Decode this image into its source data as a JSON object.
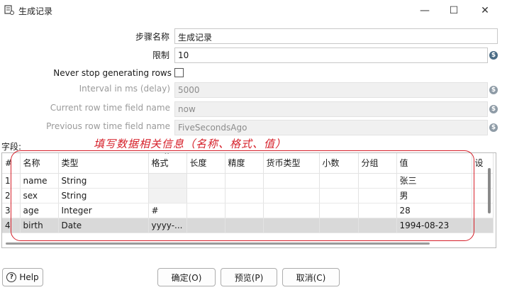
{
  "window": {
    "title": "生成记录",
    "minimize_glyph": "—",
    "maximize_glyph": "☐",
    "close_glyph": "✕"
  },
  "form": {
    "step_name_label": "步骤名称",
    "step_name_value": "生成记录",
    "limit_label": "限制",
    "limit_value": "10",
    "never_stop_label": "Never stop generating rows",
    "never_stop_checked": false,
    "interval_label": "Interval in ms (delay)",
    "interval_value": "5000",
    "current_time_label": "Current row time field name",
    "current_time_value": "now",
    "previous_time_label": "Previous row time field name",
    "previous_time_value": "FiveSecondsAgo",
    "var_icon_glyph": "$"
  },
  "fields": {
    "label": "字段:",
    "annotation": "填写数据相关信息（名称、格式、值）",
    "columns": [
      "#",
      "名称",
      "类型",
      "格式",
      "长度",
      "精度",
      "货币类型",
      "小数",
      "分组",
      "值",
      "设"
    ],
    "sort_indicator": "^",
    "rows": [
      {
        "num": "1",
        "name": "name",
        "type": "String",
        "format": "",
        "length": "",
        "precision": "",
        "currency": "",
        "decimal": "",
        "group": "",
        "value": "张三"
      },
      {
        "num": "2",
        "name": "sex",
        "type": "String",
        "format": "",
        "length": "",
        "precision": "",
        "currency": "",
        "decimal": "",
        "group": "",
        "value": "男"
      },
      {
        "num": "3",
        "name": "age",
        "type": "Integer",
        "format": "#",
        "length": "",
        "precision": "",
        "currency": "",
        "decimal": "",
        "group": "",
        "value": "28"
      },
      {
        "num": "4",
        "name": "birth",
        "type": "Date",
        "format": "yyyy-...",
        "length": "",
        "precision": "",
        "currency": "",
        "decimal": "",
        "group": "",
        "value": "1994-08-23"
      }
    ],
    "selected_row": 3
  },
  "buttons": {
    "help": "Help",
    "help_glyph": "?",
    "ok": "确定(O)",
    "preview": "预览(P)",
    "cancel": "取消(C)"
  },
  "colors": {
    "annotation": "#d6202a",
    "var_icon": "#4a6b85",
    "selected_row": "#d9d9d9"
  }
}
